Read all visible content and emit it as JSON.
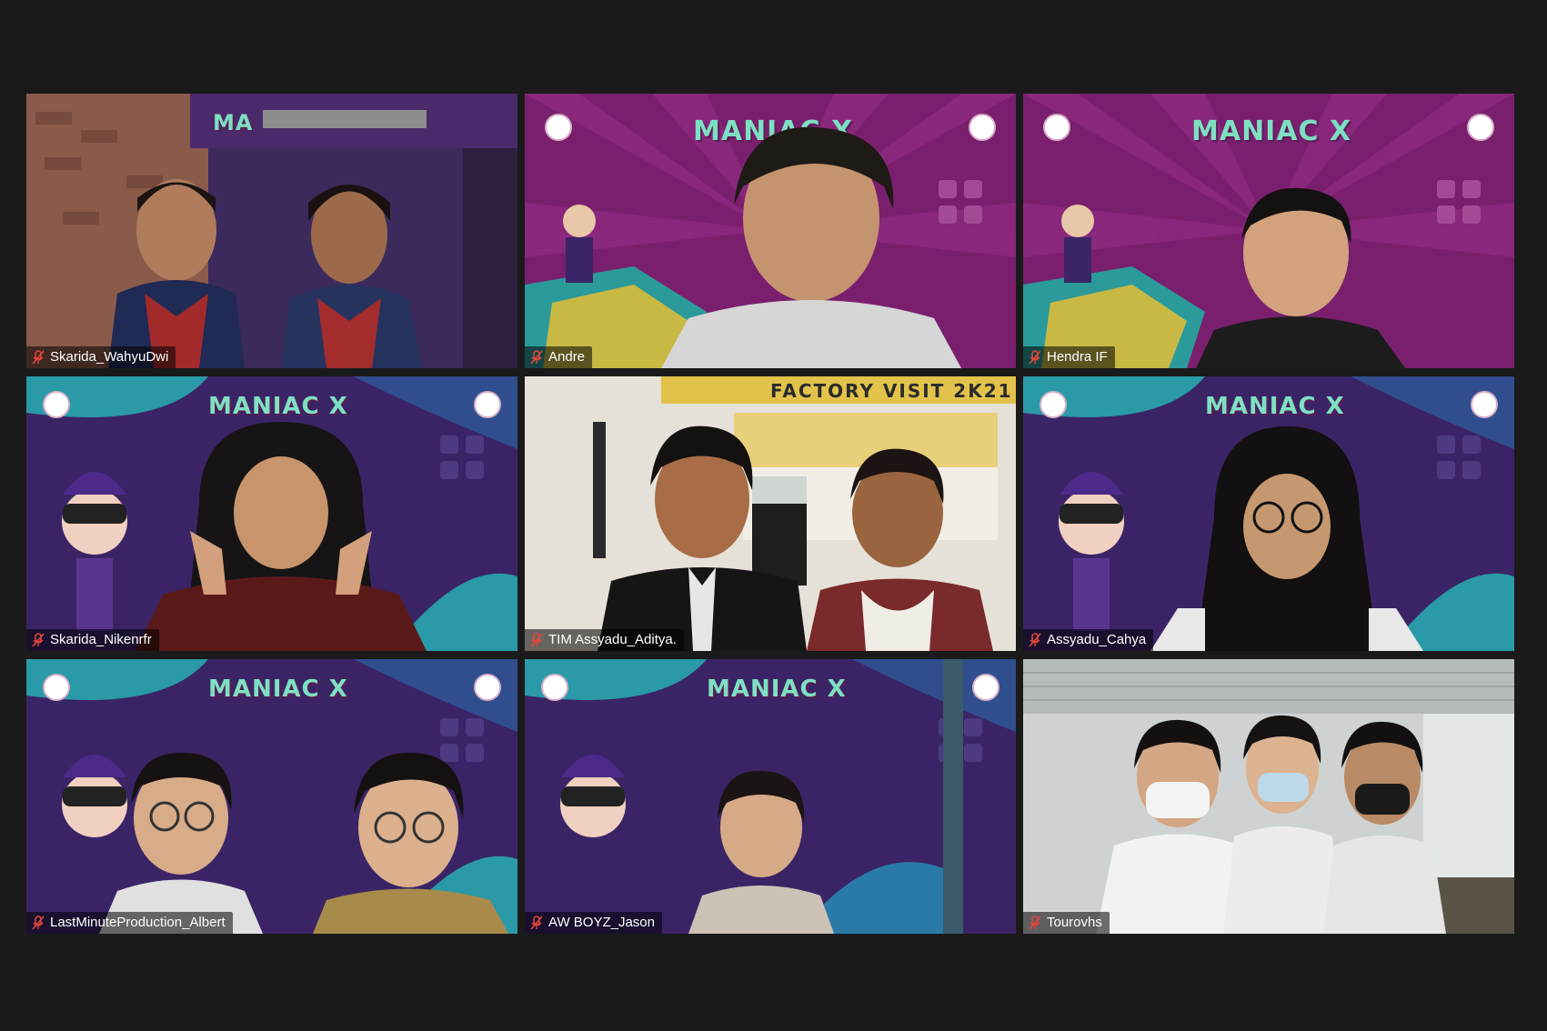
{
  "meeting": {
    "participants": [
      {
        "name": "Skarida_WahyuDwi",
        "muted": true,
        "background": "room",
        "banner": "MA"
      },
      {
        "name": "Andre",
        "muted": true,
        "background": "maniac-magenta",
        "banner": "MANIAC X"
      },
      {
        "name": "Hendra IF",
        "muted": true,
        "background": "maniac-magenta",
        "banner": "MANIAC X"
      },
      {
        "name": "Skarida_Nikenrfr",
        "muted": true,
        "background": "maniac-purple",
        "banner": "MANIAC X"
      },
      {
        "name": "TIM Assyadu_Aditya.",
        "muted": true,
        "background": "factory",
        "banner": "FACTORY VISIT 2K21"
      },
      {
        "name": "Assyadu_Cahya",
        "muted": true,
        "background": "maniac-purple",
        "banner": "MANIAC X"
      },
      {
        "name": "LastMinuteProduction_Albert",
        "muted": true,
        "background": "maniac-purple",
        "banner": "MANIAC X"
      },
      {
        "name": "AW BOYZ_Jason",
        "muted": true,
        "background": "maniac-purple",
        "banner": "MANIAC X"
      },
      {
        "name": "Tourovhs",
        "muted": true,
        "background": "school",
        "banner": ""
      }
    ]
  },
  "colors": {
    "window_bg": "#1a1a1a",
    "maniac_purple": "#3b2466",
    "maniac_magenta": "#7a1f6e",
    "banner_teal": "#7ee0c2",
    "mute_red": "#e0463b"
  },
  "icons": {
    "mute": "microphone-muted-icon"
  }
}
